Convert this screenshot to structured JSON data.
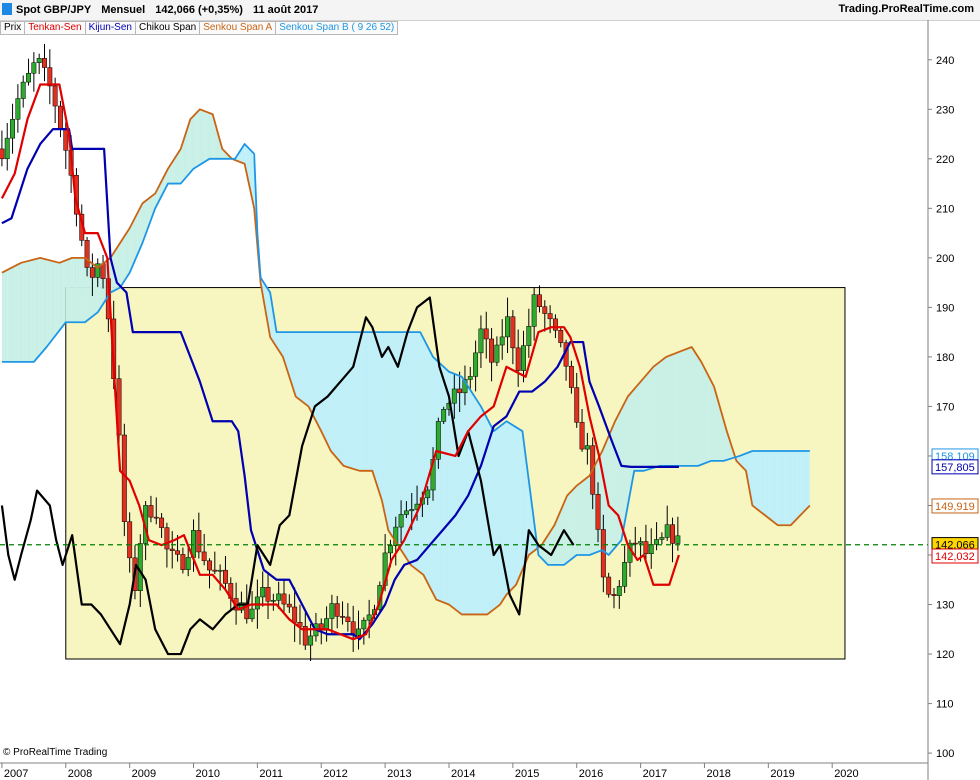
{
  "header": {
    "title": "Spot GBP/JPY",
    "period": "Mensuel",
    "quote": "142,066 (+0,35%)",
    "date": "11 août 2017",
    "site": "Trading.ProRealTime.com"
  },
  "legend": [
    {
      "label": "Prix",
      "color": "#000000"
    },
    {
      "label": "Tenkan-Sen",
      "color": "#e00000"
    },
    {
      "label": "Kijun-Sen",
      "color": "#0000b0"
    },
    {
      "label": "Chikou Span",
      "color": "#000000"
    },
    {
      "label": "Senkou Span A",
      "color": "#c86414"
    },
    {
      "label": "Senkou Span B ( 9 26 52)",
      "color": "#1e96e6"
    }
  ],
  "credit": "© ProRealTime Trading",
  "chart_data": {
    "type": "candlestick",
    "ylim": [
      98,
      245
    ],
    "y_ticks": [
      100,
      110,
      120,
      130,
      140,
      150,
      160,
      170,
      180,
      190,
      200,
      210,
      220,
      230,
      240
    ],
    "x_ticks": [
      "2007",
      "2008",
      "2009",
      "2010",
      "2011",
      "2012",
      "2013",
      "2014",
      "2015",
      "2016",
      "2017",
      "2018",
      "2019",
      "2020"
    ],
    "x_range": [
      2006.97,
      2021.5
    ],
    "colors": {
      "up": "#2eaa2e",
      "down": "#e03020",
      "tenkan": "#e00000",
      "kijun": "#0000b0",
      "chikou": "#000000",
      "span_a": "#c86414",
      "span_b": "#1e96e6",
      "cloud_bull": "#c8f0e6",
      "cloud_bear": "#bff0fa",
      "range_box": "#f7f5c0"
    },
    "range_box": {
      "x": [
        2008.0,
        2020.2
      ],
      "y": [
        119,
        194
      ]
    },
    "price_line": 142.066,
    "labels": [
      {
        "value": "158,109",
        "y": 160.0,
        "color": "#1e96e6"
      },
      {
        "value": "157,805",
        "y": 157.8,
        "color": "#0000b0"
      },
      {
        "value": "149,919",
        "y": 149.9,
        "color": "#c86414"
      },
      {
        "value": "142,066",
        "y": 142.1,
        "color": "#000000",
        "bg": "#ffd700"
      },
      {
        "value": "142,032",
        "y": 139.8,
        "color": "#e00000"
      }
    ],
    "candle_anchors": [
      [
        2007.0,
        222
      ],
      [
        2007.25,
        232
      ],
      [
        2007.55,
        240
      ],
      [
        2007.8,
        233
      ],
      [
        2008.0,
        222
      ],
      [
        2008.15,
        212
      ],
      [
        2008.35,
        195
      ],
      [
        2008.55,
        200
      ],
      [
        2008.7,
        185
      ],
      [
        2008.85,
        160
      ],
      [
        2008.95,
        140
      ],
      [
        2009.1,
        133
      ],
      [
        2009.2,
        148
      ],
      [
        2009.4,
        150
      ],
      [
        2009.6,
        140
      ],
      [
        2009.8,
        138
      ],
      [
        2010.0,
        144
      ],
      [
        2010.25,
        137
      ],
      [
        2010.45,
        135
      ],
      [
        2010.7,
        130
      ],
      [
        2010.9,
        128
      ],
      [
        2011.1,
        132
      ],
      [
        2011.3,
        131
      ],
      [
        2011.55,
        128
      ],
      [
        2011.75,
        123
      ],
      [
        2012.0,
        125
      ],
      [
        2012.2,
        130
      ],
      [
        2012.4,
        128
      ],
      [
        2012.6,
        123
      ],
      [
        2012.8,
        129
      ],
      [
        2013.0,
        140
      ],
      [
        2013.2,
        148
      ],
      [
        2013.4,
        150
      ],
      [
        2013.7,
        155
      ],
      [
        2013.9,
        170
      ],
      [
        2014.1,
        172
      ],
      [
        2014.3,
        175
      ],
      [
        2014.5,
        185
      ],
      [
        2014.7,
        178
      ],
      [
        2014.9,
        188
      ],
      [
        2015.1,
        178
      ],
      [
        2015.35,
        192
      ],
      [
        2015.6,
        186
      ],
      [
        2015.85,
        178
      ],
      [
        2016.0,
        165
      ],
      [
        2016.2,
        160
      ],
      [
        2016.4,
        135
      ],
      [
        2016.55,
        130
      ],
      [
        2016.75,
        138
      ],
      [
        2016.9,
        143
      ],
      [
        2017.1,
        140
      ],
      [
        2017.3,
        142
      ],
      [
        2017.45,
        145
      ],
      [
        2017.6,
        142.07
      ]
    ],
    "tenkan": [
      [
        2007.0,
        212
      ],
      [
        2007.2,
        217
      ],
      [
        2007.4,
        228
      ],
      [
        2007.6,
        235
      ],
      [
        2007.9,
        235
      ],
      [
        2008.05,
        225
      ],
      [
        2008.15,
        212
      ],
      [
        2008.3,
        205
      ],
      [
        2008.5,
        205
      ],
      [
        2008.65,
        200
      ],
      [
        2008.75,
        178
      ],
      [
        2008.85,
        157
      ],
      [
        2009.0,
        155
      ],
      [
        2009.15,
        150
      ],
      [
        2009.3,
        143
      ],
      [
        2009.5,
        142
      ],
      [
        2009.7,
        143
      ],
      [
        2009.85,
        144
      ],
      [
        2010.1,
        136
      ],
      [
        2010.3,
        136
      ],
      [
        2010.5,
        133
      ],
      [
        2010.7,
        129
      ],
      [
        2010.9,
        130
      ],
      [
        2011.1,
        130
      ],
      [
        2011.3,
        130
      ],
      [
        2011.5,
        127
      ],
      [
        2011.7,
        125
      ],
      [
        2011.9,
        125
      ],
      [
        2012.1,
        125
      ],
      [
        2012.3,
        124
      ],
      [
        2012.5,
        123
      ],
      [
        2012.7,
        124
      ],
      [
        2012.9,
        130
      ],
      [
        2013.1,
        139
      ],
      [
        2013.3,
        143
      ],
      [
        2013.55,
        150
      ],
      [
        2013.8,
        161
      ],
      [
        2014.1,
        160
      ],
      [
        2014.3,
        165
      ],
      [
        2014.5,
        168
      ],
      [
        2014.7,
        170
      ],
      [
        2014.9,
        178
      ],
      [
        2015.2,
        176
      ],
      [
        2015.4,
        185
      ],
      [
        2015.6,
        186
      ],
      [
        2015.8,
        186
      ],
      [
        2015.9,
        184
      ],
      [
        2016.05,
        178
      ],
      [
        2016.2,
        168
      ],
      [
        2016.35,
        160
      ],
      [
        2016.5,
        150
      ],
      [
        2016.65,
        148
      ],
      [
        2016.8,
        142
      ],
      [
        2016.95,
        139
      ],
      [
        2017.05,
        140
      ],
      [
        2017.2,
        134
      ],
      [
        2017.45,
        134
      ],
      [
        2017.6,
        140
      ]
    ],
    "kijun": [
      [
        2007.0,
        207
      ],
      [
        2007.15,
        208
      ],
      [
        2007.4,
        218
      ],
      [
        2007.6,
        223
      ],
      [
        2007.8,
        226
      ],
      [
        2008.05,
        226
      ],
      [
        2008.1,
        222
      ],
      [
        2008.6,
        222
      ],
      [
        2008.7,
        200
      ],
      [
        2008.8,
        195
      ],
      [
        2008.95,
        193
      ],
      [
        2009.05,
        185
      ],
      [
        2009.2,
        185
      ],
      [
        2009.8,
        185
      ],
      [
        2009.95,
        180
      ],
      [
        2010.1,
        175
      ],
      [
        2010.3,
        167
      ],
      [
        2010.6,
        167
      ],
      [
        2010.7,
        165
      ],
      [
        2010.8,
        156
      ],
      [
        2010.9,
        145
      ],
      [
        2011.1,
        137
      ],
      [
        2011.3,
        135
      ],
      [
        2011.5,
        135
      ],
      [
        2011.7,
        130
      ],
      [
        2011.9,
        125
      ],
      [
        2012.1,
        124
      ],
      [
        2012.5,
        124
      ],
      [
        2012.6,
        123
      ],
      [
        2012.8,
        126
      ],
      [
        2013.0,
        130
      ],
      [
        2013.15,
        135
      ],
      [
        2013.3,
        138
      ],
      [
        2013.5,
        139
      ],
      [
        2013.7,
        142
      ],
      [
        2013.9,
        145
      ],
      [
        2014.1,
        148
      ],
      [
        2014.3,
        152
      ],
      [
        2014.5,
        158
      ],
      [
        2014.7,
        166
      ],
      [
        2014.9,
        168
      ],
      [
        2015.1,
        173
      ],
      [
        2015.3,
        173
      ],
      [
        2015.5,
        175
      ],
      [
        2015.7,
        178
      ],
      [
        2015.9,
        183
      ],
      [
        2016.1,
        183
      ],
      [
        2016.2,
        175
      ],
      [
        2016.35,
        170
      ],
      [
        2016.55,
        163
      ],
      [
        2016.7,
        158
      ],
      [
        2016.85,
        157.8
      ],
      [
        2017.5,
        157.8
      ],
      [
        2017.6,
        157.8
      ]
    ],
    "chikou": [
      [
        2007.0,
        150
      ],
      [
        2007.1,
        140
      ],
      [
        2007.2,
        135
      ],
      [
        2007.3,
        140
      ],
      [
        2007.45,
        147
      ],
      [
        2007.55,
        153
      ],
      [
        2007.75,
        150
      ],
      [
        2007.85,
        143
      ],
      [
        2007.95,
        138
      ],
      [
        2008.1,
        144
      ],
      [
        2008.25,
        130
      ],
      [
        2008.4,
        130
      ],
      [
        2008.55,
        128
      ],
      [
        2008.7,
        125
      ],
      [
        2008.85,
        122
      ],
      [
        2009.0,
        130
      ],
      [
        2009.1,
        138
      ],
      [
        2009.25,
        135
      ],
      [
        2009.4,
        125
      ],
      [
        2009.6,
        120
      ],
      [
        2009.8,
        120
      ],
      [
        2009.95,
        125
      ],
      [
        2010.1,
        127
      ],
      [
        2010.3,
        125
      ],
      [
        2010.5,
        128
      ],
      [
        2010.7,
        130
      ],
      [
        2010.85,
        130
      ],
      [
        2011.0,
        142
      ],
      [
        2011.2,
        138
      ],
      [
        2011.35,
        146
      ],
      [
        2011.5,
        148
      ],
      [
        2011.7,
        162
      ],
      [
        2011.9,
        170
      ],
      [
        2012.1,
        172
      ],
      [
        2012.3,
        175
      ],
      [
        2012.5,
        178
      ],
      [
        2012.7,
        188
      ],
      [
        2012.8,
        186
      ],
      [
        2012.95,
        180
      ],
      [
        2013.05,
        182
      ],
      [
        2013.2,
        178
      ],
      [
        2013.35,
        185
      ],
      [
        2013.5,
        190
      ],
      [
        2013.7,
        192
      ],
      [
        2013.85,
        178
      ],
      [
        2014.0,
        172
      ],
      [
        2014.15,
        160
      ],
      [
        2014.3,
        165
      ],
      [
        2014.5,
        155
      ],
      [
        2014.7,
        140
      ],
      [
        2014.8,
        142
      ],
      [
        2014.95,
        132
      ],
      [
        2015.1,
        128
      ],
      [
        2015.25,
        145
      ],
      [
        2015.4,
        142
      ],
      [
        2015.6,
        140
      ],
      [
        2015.8,
        145
      ],
      [
        2015.95,
        142
      ]
    ],
    "span_a": [
      [
        2007.0,
        197
      ],
      [
        2007.3,
        199
      ],
      [
        2007.6,
        200
      ],
      [
        2007.9,
        199
      ],
      [
        2008.1,
        200
      ],
      [
        2008.3,
        200
      ],
      [
        2008.5,
        198
      ],
      [
        2008.7,
        200
      ],
      [
        2009.0,
        206
      ],
      [
        2009.2,
        211
      ],
      [
        2009.4,
        213
      ],
      [
        2009.6,
        218
      ],
      [
        2009.8,
        222
      ],
      [
        2009.95,
        228
      ],
      [
        2010.1,
        230
      ],
      [
        2010.3,
        229
      ],
      [
        2010.45,
        222
      ],
      [
        2010.6,
        220
      ],
      [
        2010.8,
        219
      ],
      [
        2010.95,
        210
      ],
      [
        2011.05,
        195
      ],
      [
        2011.2,
        184
      ],
      [
        2011.4,
        180
      ],
      [
        2011.6,
        172
      ],
      [
        2011.8,
        170
      ],
      [
        2012.0,
        165
      ],
      [
        2012.15,
        161
      ],
      [
        2012.35,
        158
      ],
      [
        2012.6,
        157
      ],
      [
        2012.8,
        157
      ],
      [
        2012.95,
        151
      ],
      [
        2013.05,
        145
      ],
      [
        2013.2,
        142
      ],
      [
        2013.4,
        138
      ],
      [
        2013.6,
        136
      ],
      [
        2013.8,
        131
      ],
      [
        2014.0,
        130
      ],
      [
        2014.2,
        128
      ],
      [
        2014.4,
        128
      ],
      [
        2014.6,
        128
      ],
      [
        2014.8,
        130
      ],
      [
        2014.9,
        132
      ],
      [
        2015.05,
        134
      ],
      [
        2015.25,
        140
      ],
      [
        2015.45,
        142
      ],
      [
        2015.65,
        146
      ],
      [
        2015.85,
        152
      ],
      [
        2016.0,
        154
      ],
      [
        2016.2,
        156
      ],
      [
        2016.4,
        161
      ],
      [
        2016.6,
        167
      ],
      [
        2016.8,
        172
      ],
      [
        2017.0,
        175
      ],
      [
        2017.2,
        178
      ],
      [
        2017.4,
        180
      ],
      [
        2017.6,
        181
      ],
      [
        2017.8,
        182
      ],
      [
        2017.95,
        179
      ],
      [
        2018.15,
        174
      ],
      [
        2018.35,
        165
      ],
      [
        2018.5,
        159
      ],
      [
        2018.65,
        157
      ],
      [
        2018.75,
        150
      ],
      [
        2018.95,
        148
      ],
      [
        2019.15,
        146
      ],
      [
        2019.35,
        146
      ],
      [
        2019.5,
        148
      ],
      [
        2019.65,
        150
      ]
    ],
    "span_b": [
      [
        2007.0,
        179
      ],
      [
        2007.5,
        179
      ],
      [
        2007.7,
        182
      ],
      [
        2008.0,
        187
      ],
      [
        2008.3,
        187
      ],
      [
        2008.5,
        189
      ],
      [
        2008.7,
        193
      ],
      [
        2008.85,
        194
      ],
      [
        2009.0,
        197
      ],
      [
        2009.2,
        203
      ],
      [
        2009.4,
        210
      ],
      [
        2009.6,
        215
      ],
      [
        2009.8,
        215
      ],
      [
        2010.0,
        218
      ],
      [
        2010.25,
        220
      ],
      [
        2010.45,
        220
      ],
      [
        2010.65,
        220
      ],
      [
        2010.8,
        223
      ],
      [
        2010.95,
        221
      ],
      [
        2011.0,
        205
      ],
      [
        2011.05,
        196
      ],
      [
        2011.2,
        193
      ],
      [
        2011.3,
        185
      ],
      [
        2012.2,
        185
      ],
      [
        2012.8,
        185
      ],
      [
        2013.0,
        185
      ],
      [
        2013.3,
        185
      ],
      [
        2013.55,
        185
      ],
      [
        2013.75,
        180
      ],
      [
        2014.0,
        177
      ],
      [
        2014.2,
        176
      ],
      [
        2014.5,
        170
      ],
      [
        2014.7,
        165
      ],
      [
        2014.9,
        167
      ],
      [
        2015.15,
        165
      ],
      [
        2015.25,
        155
      ],
      [
        2015.4,
        140
      ],
      [
        2015.55,
        138
      ],
      [
        2015.8,
        138
      ],
      [
        2016.0,
        140
      ],
      [
        2016.2,
        140
      ],
      [
        2016.4,
        141
      ],
      [
        2016.5,
        140
      ],
      [
        2016.7,
        143
      ],
      [
        2016.9,
        157
      ],
      [
        2017.05,
        157
      ],
      [
        2017.3,
        158
      ],
      [
        2017.5,
        158
      ],
      [
        2017.7,
        158
      ],
      [
        2017.9,
        158
      ],
      [
        2018.1,
        159
      ],
      [
        2018.3,
        159
      ],
      [
        2018.55,
        160
      ],
      [
        2018.75,
        161
      ],
      [
        2019.0,
        161
      ],
      [
        2019.3,
        161
      ],
      [
        2019.65,
        161
      ]
    ]
  }
}
